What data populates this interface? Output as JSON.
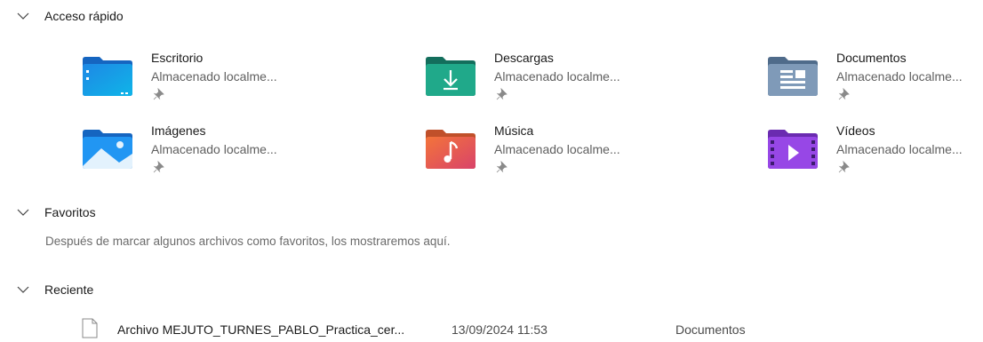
{
  "quick_access": {
    "title": "Acceso rápido",
    "items": [
      {
        "name": "Escritorio",
        "sub": "Almacenado localme...",
        "icon": "desktop-folder-icon"
      },
      {
        "name": "Descargas",
        "sub": "Almacenado localme...",
        "icon": "downloads-folder-icon"
      },
      {
        "name": "Documentos",
        "sub": "Almacenado localme...",
        "icon": "documents-folder-icon"
      },
      {
        "name": "Imágenes",
        "sub": "Almacenado localme...",
        "icon": "pictures-folder-icon"
      },
      {
        "name": "Música",
        "sub": "Almacenado localme...",
        "icon": "music-folder-icon"
      },
      {
        "name": "Vídeos",
        "sub": "Almacenado localme...",
        "icon": "videos-folder-icon"
      }
    ]
  },
  "favorites": {
    "title": "Favoritos",
    "empty_message": "Después de marcar algunos archivos como favoritos, los mostraremos aquí."
  },
  "recent": {
    "title": "Reciente",
    "items": [
      {
        "name": "Archivo MEJUTO_TURNES_PABLO_Practica_cer...",
        "date": "13/09/2024 11:53",
        "location": "Documentos",
        "icon": "file-icon"
      }
    ]
  },
  "colors": {
    "accent_blue": "#1e88e5",
    "downloads_teal": "#20a98a",
    "documents_gray": "#6f8aa7",
    "music_orange": "#e8603a",
    "videos_purple": "#8b3fd9"
  }
}
